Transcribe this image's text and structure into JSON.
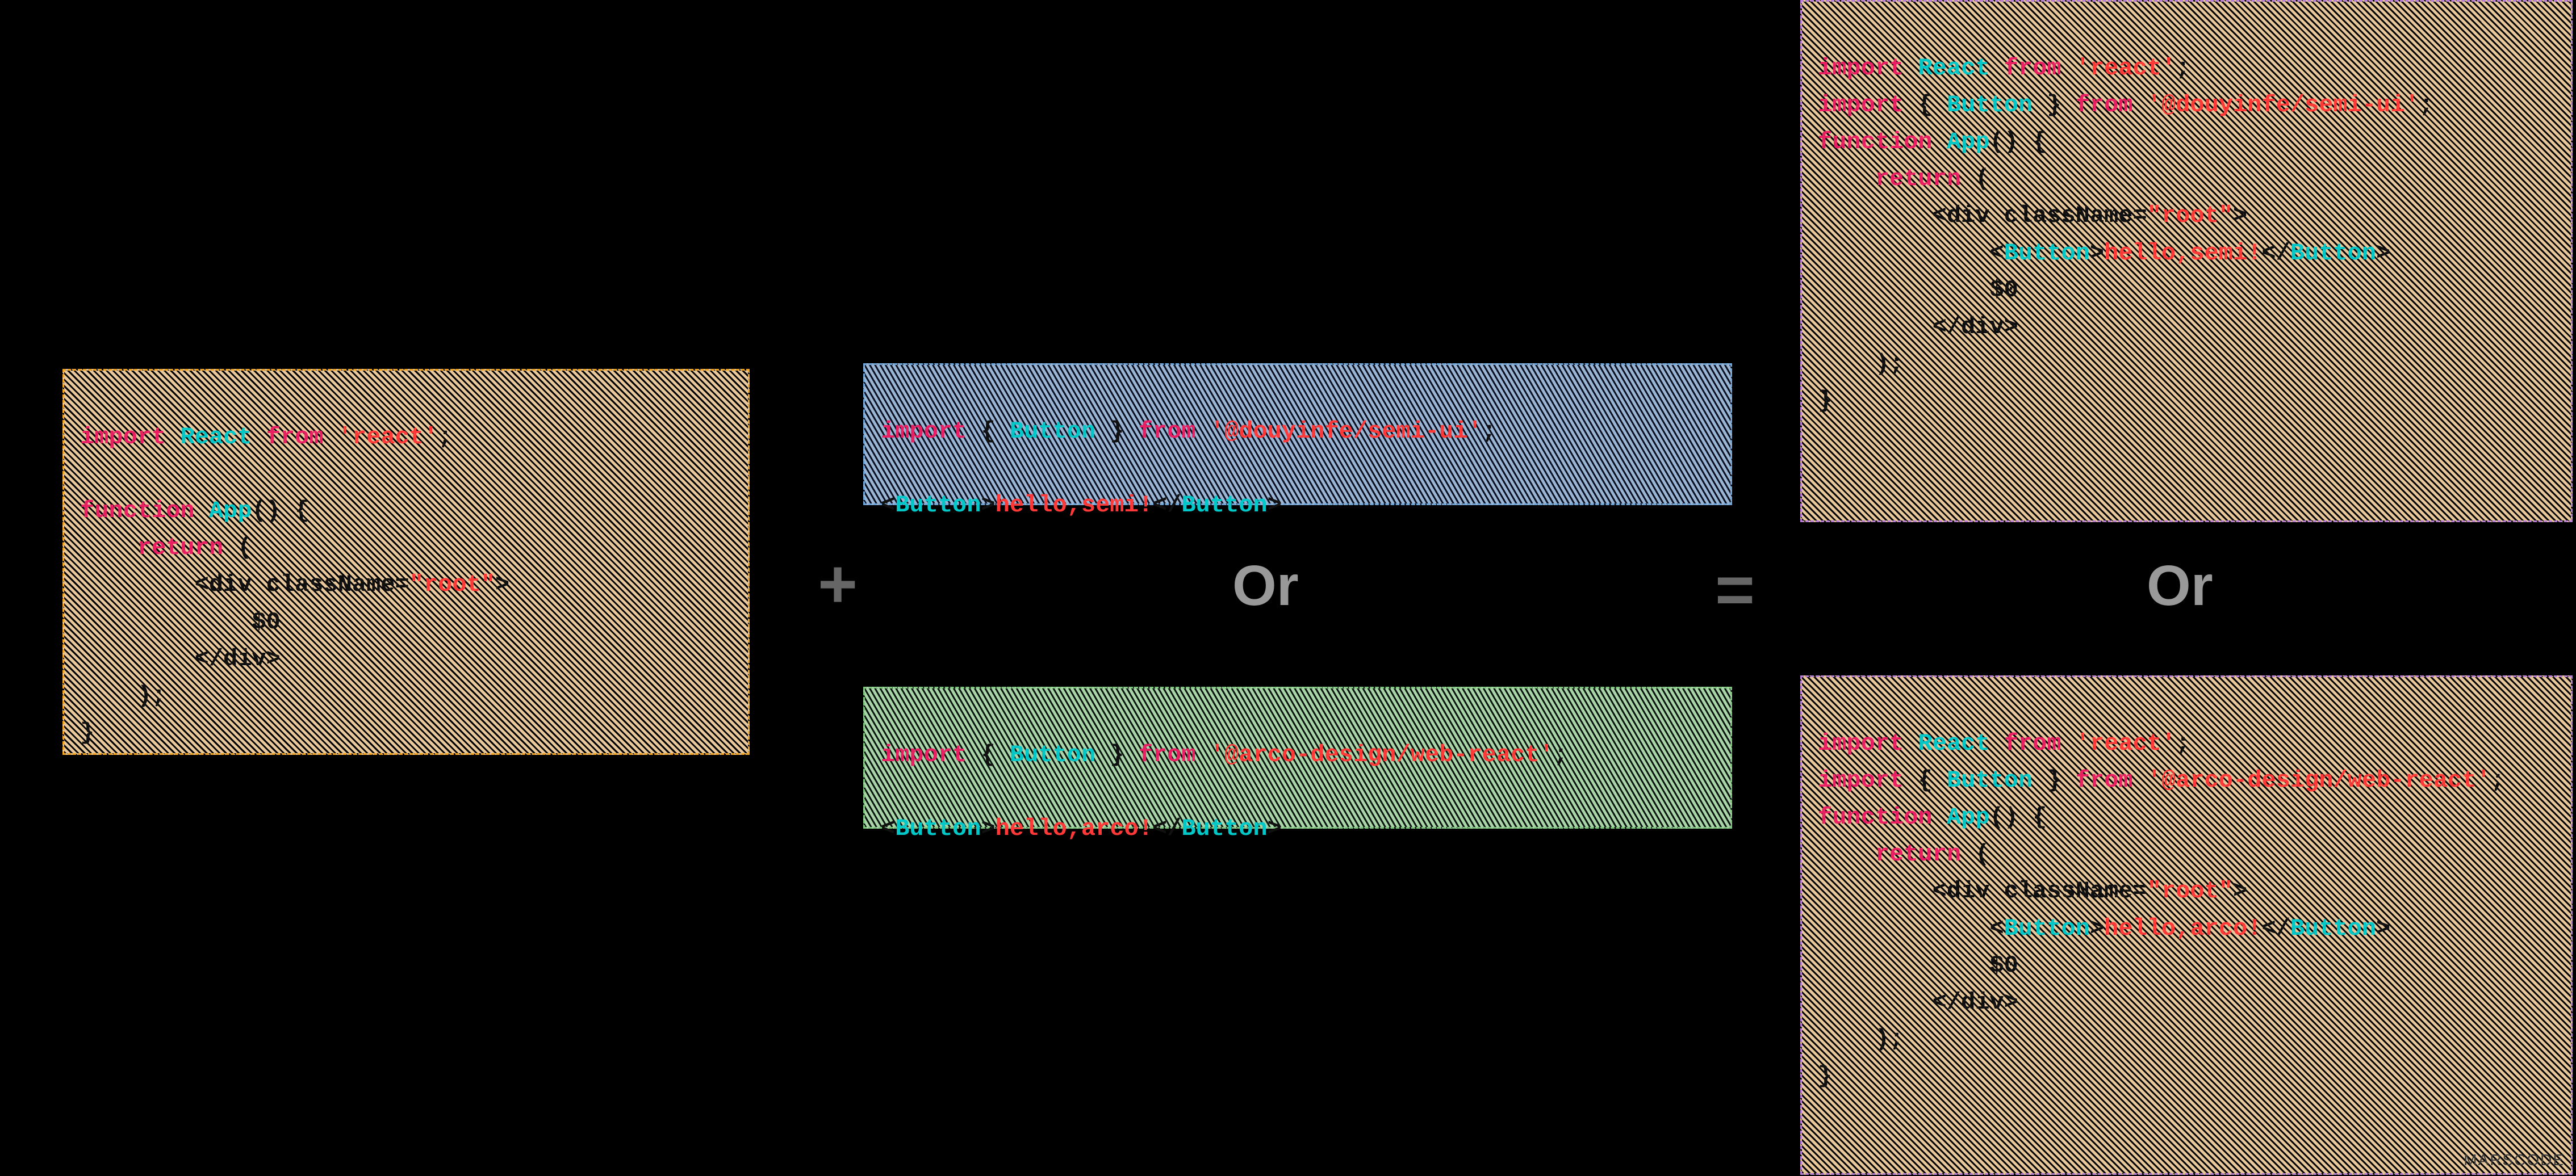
{
  "box1": {
    "l1_a": "import",
    "l1_b": "React",
    "l1_c": "from",
    "l1_d": "'react'",
    "l1_e": ";",
    "l2": "",
    "l3_a": "function",
    "l3_b": "App",
    "l3_c": "() {",
    "l4_a": "    return",
    "l4_b": " (",
    "l5_a": "        <div className=",
    "l5_b": "\"root\"",
    "l5_c": ">",
    "l6": "            $0",
    "l7": "        </div>",
    "l8": "    );",
    "l9": "}"
  },
  "box2": {
    "l1_a": "import",
    "l1_b": " { ",
    "l1_c": "Button",
    "l1_d": " } ",
    "l1_e": "from",
    "l1_f": "'@douyinfe/semi-ui'",
    "l1_g": ";",
    "l2": "",
    "l3_a": "<",
    "l3_b": "Button",
    "l3_c": ">",
    "l3_d": "hello,semi!",
    "l3_e": "</",
    "l3_f": "Button",
    "l3_g": ">"
  },
  "box3": {
    "l1_a": "import",
    "l1_b": " { ",
    "l1_c": "Button",
    "l1_d": " } ",
    "l1_e": "from",
    "l1_f": "'@arco-design/web-react'",
    "l1_g": ";",
    "l2": "",
    "l3_a": "<",
    "l3_b": "Button",
    "l3_c": ">",
    "l3_d": "hello,arco!",
    "l3_e": "</",
    "l3_f": "Button",
    "l3_g": ">"
  },
  "box4": {
    "l1_a": "import",
    "l1_b": "React",
    "l1_c": "from",
    "l1_d": "'react'",
    "l1_e": ";",
    "l2_a": "import",
    "l2_b": " { ",
    "l2_c": "Button",
    "l2_d": " } ",
    "l2_e": "from",
    "l2_f": "'@douyinfe/semi-ui'",
    "l2_g": ";",
    "l3_a": "function",
    "l3_b": "App",
    "l3_c": "() {",
    "l4_a": "    return",
    "l4_b": " (",
    "l5_a": "        <div className=",
    "l5_b": "\"root\"",
    "l5_c": ">",
    "l6_a": "            <",
    "l6_b": "Button",
    "l6_c": ">",
    "l6_d": "hello,semi!",
    "l6_e": "</",
    "l6_f": "Button",
    "l6_g": ">",
    "l7": "            $0",
    "l8": "        </div>",
    "l9": "    );",
    "l10": "}"
  },
  "box5": {
    "l1_a": "import",
    "l1_b": "React",
    "l1_c": "from",
    "l1_d": "'react'",
    "l1_e": ";",
    "l2_a": "import",
    "l2_b": " { ",
    "l2_c": "Button",
    "l2_d": " } ",
    "l2_e": "from",
    "l2_f": "'@arco-design/web-react'",
    "l2_g": ";",
    "l3_a": "function",
    "l3_b": "App",
    "l3_c": "() {",
    "l4_a": "    return",
    "l4_b": " (",
    "l5_a": "        <div className=",
    "l5_b": "\"root\"",
    "l5_c": ">",
    "l6_a": "            <",
    "l6_b": "Button",
    "l6_c": ">",
    "l6_d": "hello,arco!",
    "l6_e": "</",
    "l6_f": "Button",
    "l6_g": ">",
    "l7": "            $0",
    "l8": "        </div>",
    "l9": "    );",
    "l10": "}"
  },
  "labels": {
    "plus": "+",
    "eq": "=",
    "or1": "Or",
    "or2": "Or",
    "watermark": "MARSCODE"
  }
}
